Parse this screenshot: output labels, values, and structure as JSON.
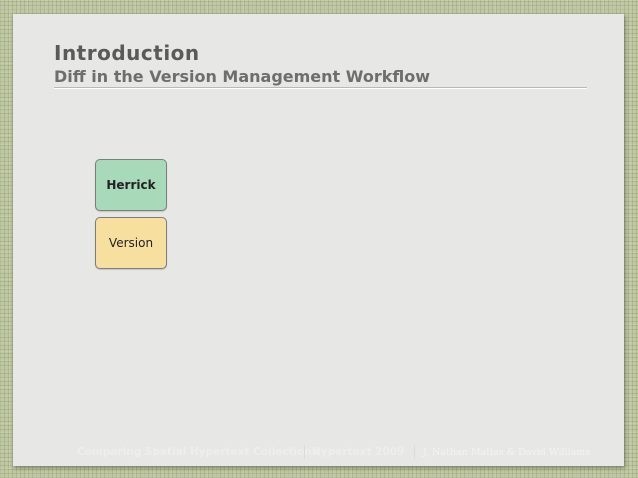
{
  "slide": {
    "title": "Introduction",
    "subtitle": "Diff in the Version Management Workflow"
  },
  "diagram": {
    "boxes": [
      {
        "label": "Herrick",
        "color": "#a8d9b9"
      },
      {
        "label": "Version",
        "color": "#f6df9f"
      }
    ]
  },
  "footer": {
    "collection": "Comparing Spatial Hypertext Collections",
    "event": "Hypertext 2009",
    "authors": "J. Nathan Matias & David Williams"
  },
  "colors": {
    "background": "#bfc7a3",
    "slide": "#e7e7e5"
  }
}
